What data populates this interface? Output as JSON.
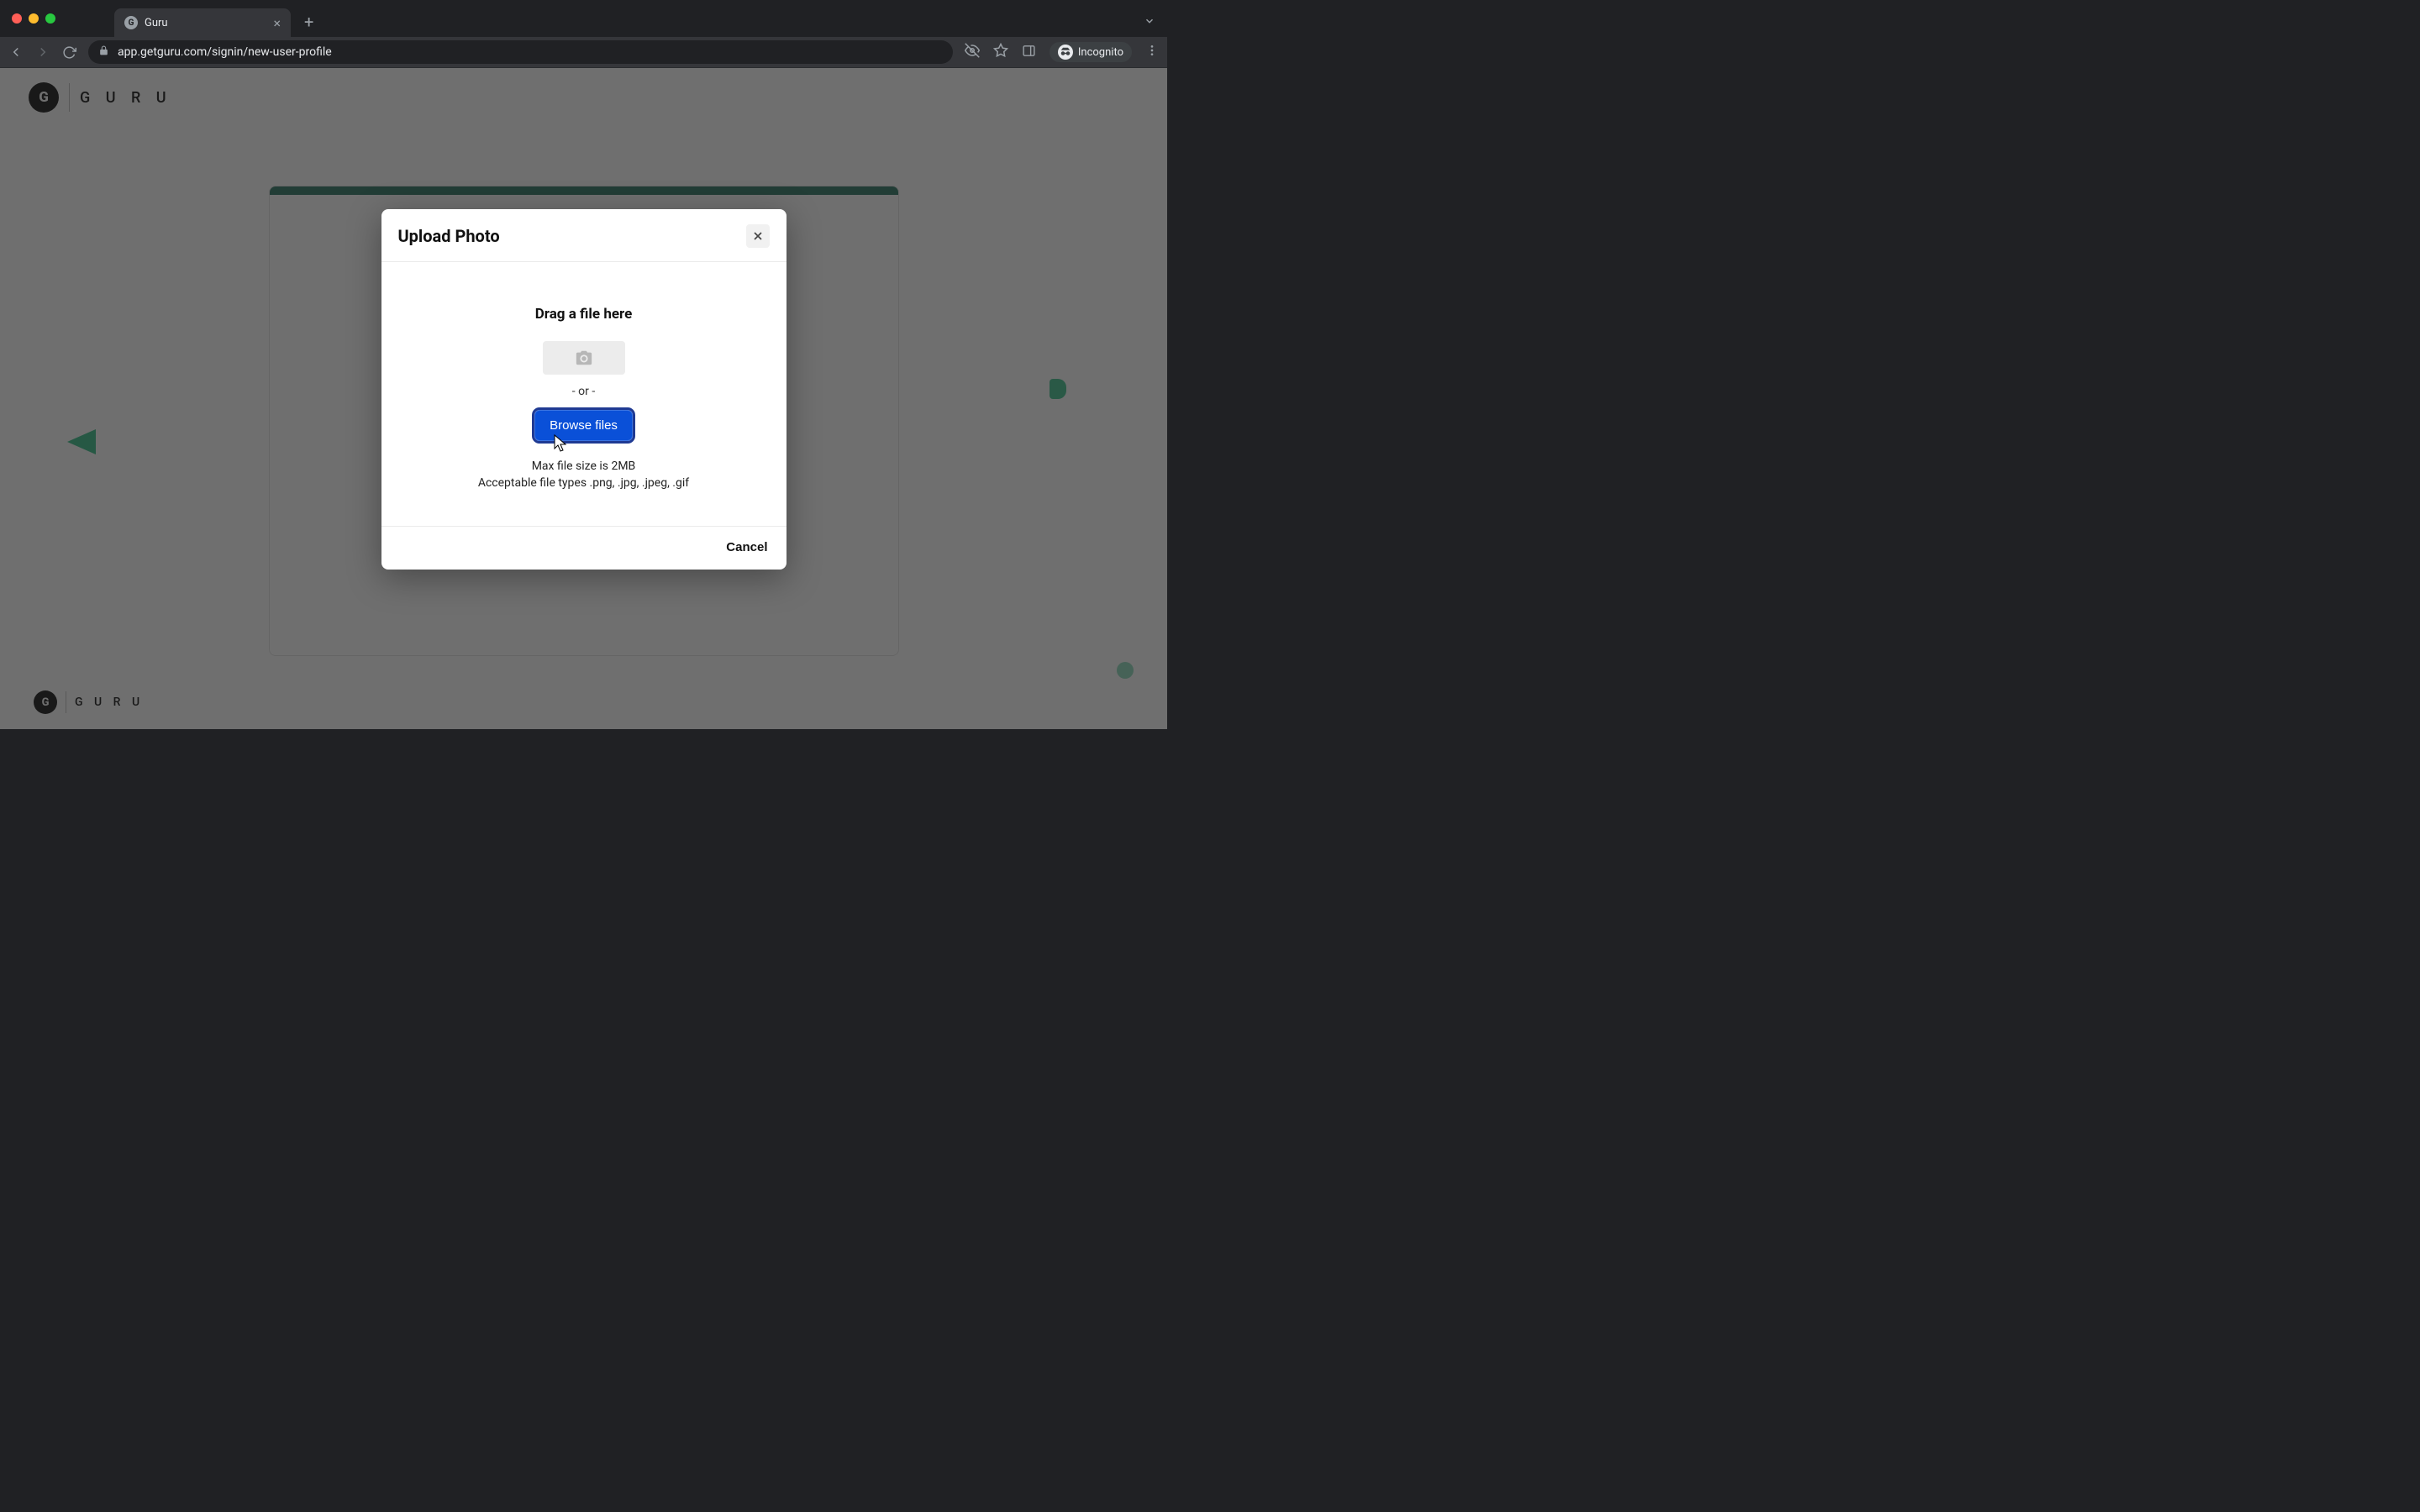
{
  "browser": {
    "tab_title": "Guru",
    "url": "app.getguru.com/signin/new-user-profile",
    "incognito_label": "Incognito"
  },
  "app": {
    "brand_word": "G U R U"
  },
  "modal": {
    "title": "Upload Photo",
    "drag_title": "Drag a file here",
    "or_text": "- or -",
    "browse_label": "Browse files",
    "max_size_text": "Max file size is 2MB",
    "file_types_text": "Acceptable file types .png, .jpg, .jpeg, .gif",
    "cancel_label": "Cancel"
  }
}
